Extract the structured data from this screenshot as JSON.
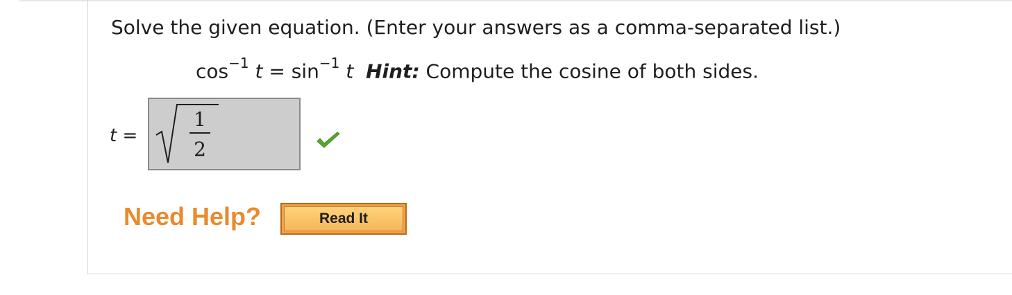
{
  "question": {
    "prompt": "Solve the given equation. (Enter your answers as a comma-separated list.)",
    "equation": {
      "lhs_func": "cos",
      "lhs_exp": "−1",
      "lhs_var": "t",
      "equals": "=",
      "rhs_func": "sin",
      "rhs_exp": "−1",
      "rhs_var": "t",
      "hint_label": "Hint:",
      "hint_text": "Compute the cosine of both sides."
    }
  },
  "answer": {
    "label": "t =",
    "numerator": "1",
    "denominator": "2",
    "status": "correct",
    "status_color": "#5aa636"
  },
  "help": {
    "label": "Need Help?",
    "read_it_label": "Read It",
    "accent_color": "#e98a2c"
  }
}
